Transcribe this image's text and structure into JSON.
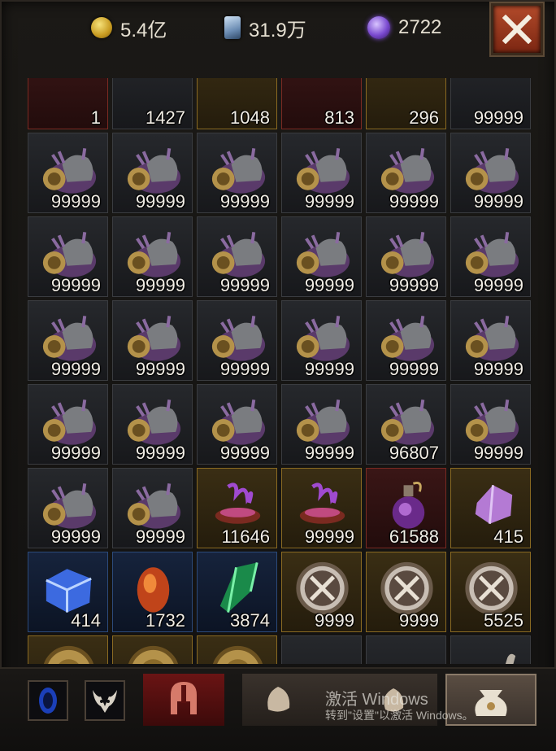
{
  "currencies": [
    {
      "icon": "gold-coin-icon",
      "value": "5.4亿"
    },
    {
      "icon": "ticket-card-icon",
      "value": "31.9万"
    },
    {
      "icon": "purple-orb-icon",
      "value": "2722"
    }
  ],
  "close_icon": "close-icon",
  "inventory": [
    {
      "icon": "partial-item-icon",
      "qty": "1",
      "rarity": "red"
    },
    {
      "icon": "partial-item-icon",
      "qty": "1427",
      "rarity": "grey"
    },
    {
      "icon": "partial-item-icon",
      "qty": "1048",
      "rarity": "gold"
    },
    {
      "icon": "partial-item-icon",
      "qty": "813",
      "rarity": "red"
    },
    {
      "icon": "partial-item-icon",
      "qty": "296",
      "rarity": "gold"
    },
    {
      "icon": "partial-item-icon",
      "qty": "99999",
      "rarity": "grey"
    },
    {
      "icon": "demon-helmet-icon",
      "qty": "99999",
      "rarity": "grey"
    },
    {
      "icon": "demon-helmet-icon",
      "qty": "99999",
      "rarity": "grey"
    },
    {
      "icon": "demon-helmet-icon",
      "qty": "99999",
      "rarity": "grey"
    },
    {
      "icon": "demon-helmet-icon",
      "qty": "99999",
      "rarity": "grey"
    },
    {
      "icon": "demon-helmet-icon",
      "qty": "99999",
      "rarity": "grey"
    },
    {
      "icon": "demon-helmet-icon",
      "qty": "99999",
      "rarity": "grey"
    },
    {
      "icon": "demon-helmet-icon",
      "qty": "99999",
      "rarity": "grey"
    },
    {
      "icon": "demon-helmet-icon",
      "qty": "99999",
      "rarity": "grey"
    },
    {
      "icon": "demon-helmet-icon",
      "qty": "99999",
      "rarity": "grey"
    },
    {
      "icon": "demon-helmet-icon",
      "qty": "99999",
      "rarity": "grey"
    },
    {
      "icon": "demon-helmet-icon",
      "qty": "99999",
      "rarity": "grey"
    },
    {
      "icon": "demon-helmet-icon",
      "qty": "99999",
      "rarity": "grey"
    },
    {
      "icon": "demon-helmet-icon",
      "qty": "99999",
      "rarity": "grey"
    },
    {
      "icon": "demon-helmet-icon",
      "qty": "99999",
      "rarity": "grey"
    },
    {
      "icon": "demon-helmet-icon",
      "qty": "99999",
      "rarity": "grey"
    },
    {
      "icon": "demon-helmet-icon",
      "qty": "99999",
      "rarity": "grey"
    },
    {
      "icon": "demon-helmet-icon",
      "qty": "99999",
      "rarity": "grey"
    },
    {
      "icon": "demon-helmet-icon",
      "qty": "99999",
      "rarity": "grey"
    },
    {
      "icon": "demon-helmet-icon",
      "qty": "99999",
      "rarity": "grey"
    },
    {
      "icon": "demon-helmet-icon",
      "qty": "99999",
      "rarity": "grey"
    },
    {
      "icon": "demon-helmet-icon",
      "qty": "99999",
      "rarity": "grey"
    },
    {
      "icon": "demon-helmet-icon",
      "qty": "99999",
      "rarity": "grey"
    },
    {
      "icon": "demon-helmet-icon",
      "qty": "96807",
      "rarity": "grey"
    },
    {
      "icon": "demon-helmet-icon",
      "qty": "99999",
      "rarity": "grey"
    },
    {
      "icon": "demon-helmet-icon",
      "qty": "99999",
      "rarity": "grey"
    },
    {
      "icon": "demon-helmet-icon",
      "qty": "99999",
      "rarity": "grey"
    },
    {
      "icon": "purple-smoke-brazier-icon",
      "qty": "11646",
      "rarity": "gold"
    },
    {
      "icon": "purple-smoke-brazier-icon",
      "qty": "99999",
      "rarity": "gold"
    },
    {
      "icon": "purple-potion-flask-icon",
      "qty": "61588",
      "rarity": "red"
    },
    {
      "icon": "pink-crystal-ore-icon",
      "qty": "415",
      "rarity": "gold"
    },
    {
      "icon": "blue-ice-cube-icon",
      "qty": "414",
      "rarity": "blue"
    },
    {
      "icon": "fire-egg-icon",
      "qty": "1732",
      "rarity": "blue"
    },
    {
      "icon": "green-crystal-shard-icon",
      "qty": "3874",
      "rarity": "blue"
    },
    {
      "icon": "crossed-swords-medal-icon",
      "qty": "9999",
      "rarity": "gold"
    },
    {
      "icon": "crossed-swords-medal-icon",
      "qty": "9999",
      "rarity": "gold"
    },
    {
      "icon": "crossed-swords-medal-icon",
      "qty": "5525",
      "rarity": "gold"
    },
    {
      "icon": "gold-skull-medal-icon",
      "qty": "",
      "rarity": "gold"
    },
    {
      "icon": "gold-skull-medal-icon",
      "qty": "",
      "rarity": "gold"
    },
    {
      "icon": "gold-skull-medal-icon",
      "qty": "",
      "rarity": "gold"
    },
    {
      "icon": "dark-ore-pile-icon",
      "qty": "",
      "rarity": "grey"
    },
    {
      "icon": "dark-ore-pile-icon",
      "qty": "",
      "rarity": "grey"
    },
    {
      "icon": "bone-fragment-icon",
      "qty": "",
      "rarity": "grey"
    }
  ],
  "bottom_tabs": [
    {
      "icon": "blue-portal-icon"
    },
    {
      "icon": "horned-demon-icon"
    },
    {
      "icon": "spartan-helmet-icon"
    },
    {
      "icon": "crafting-material-icon"
    },
    {
      "icon": "loot-bag-icon"
    }
  ],
  "watermark": {
    "line1": "激活 Windows",
    "line2": "转到\"设置\"以激活 Windows。"
  },
  "colors": {
    "gold_border": "#8a6a22",
    "red_border": "#7a2a22",
    "blue_border": "#2c4a7a",
    "close_button": "#9c3a1e"
  }
}
